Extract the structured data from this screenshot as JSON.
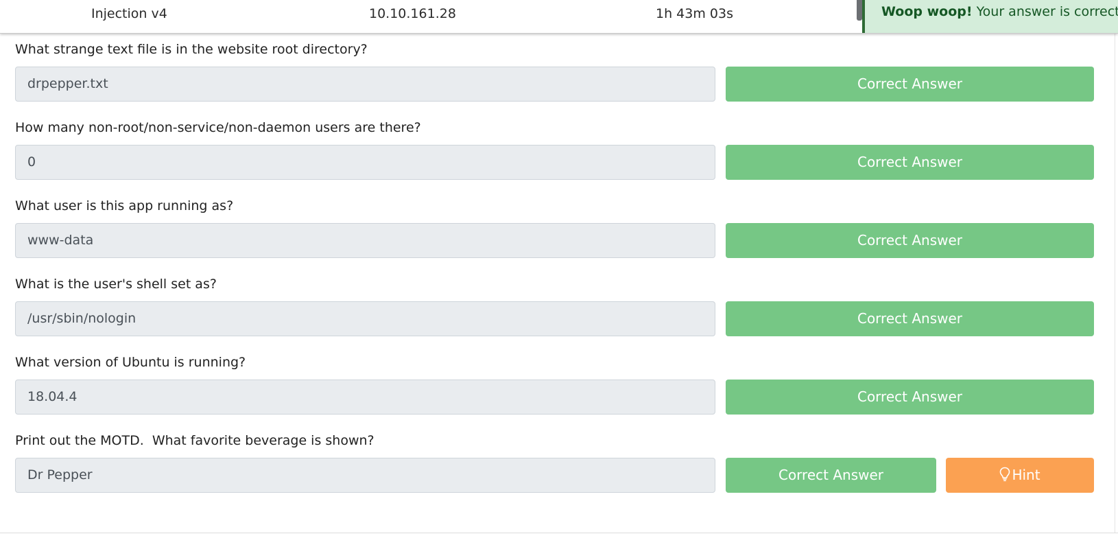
{
  "header": {
    "room_name": "Injection v4",
    "ip_address": "10.10.161.28",
    "time_remaining": "1h 43m 03s"
  },
  "toast": {
    "title": "Woop woop!",
    "message": "Your answer is correct"
  },
  "questions": [
    {
      "text": "What strange text file is in the website root directory?",
      "answer": "drpepper.txt",
      "button": "Correct Answer"
    },
    {
      "text": "How many non-root/non-service/non-daemon users are there?",
      "answer": "0",
      "button": "Correct Answer"
    },
    {
      "text": "What user is this app running as?",
      "answer": "www-data",
      "button": "Correct Answer"
    },
    {
      "text": "What is the user's shell set as?",
      "answer": "/usr/sbin/nologin",
      "button": "Correct Answer"
    },
    {
      "text": "What version of Ubuntu is running?",
      "answer": "18.04.4",
      "button": "Correct Answer"
    },
    {
      "text": "Print out the MOTD.  What favorite beverage is shown?",
      "answer": "Dr Pepper",
      "button": "Correct Answer",
      "hint_label": "Hint"
    }
  ],
  "colors": {
    "correct_button": "#76c785",
    "hint_button": "#fba152",
    "toast_bg": "#d4edda",
    "field_bg": "#e9ecef"
  },
  "icons": {
    "hint": "lightbulb-icon"
  }
}
